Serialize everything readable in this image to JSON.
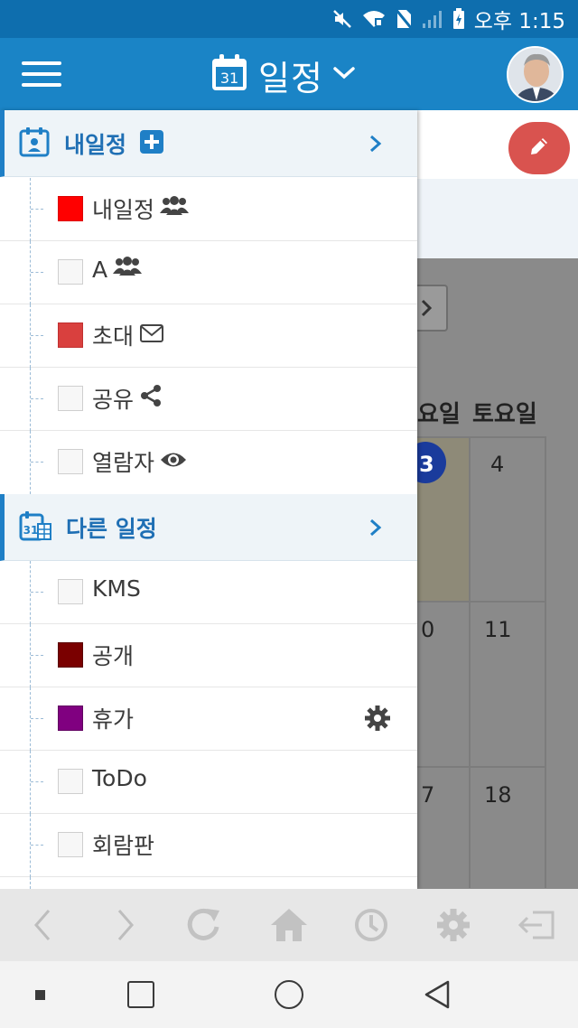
{
  "status_bar": {
    "time": "오후 1:15",
    "icons": [
      "mute-icon",
      "wifi-icon",
      "no-sim-icon",
      "signal-icon",
      "battery-icon"
    ]
  },
  "app_bar": {
    "title": "일정",
    "calendar_icon_day": "31",
    "menu_icon": "hamburger-icon",
    "dropdown_icon": "chevron-down-icon",
    "avatar": "user-avatar"
  },
  "background_calendar": {
    "weekday_headers": [
      "요일",
      "토요일"
    ],
    "rows": [
      {
        "left": "3",
        "right": "4",
        "left_highlight": true
      },
      {
        "left": "0",
        "right": "11"
      },
      {
        "left": "7",
        "right": "18"
      }
    ]
  },
  "drawer": {
    "my_schedule": {
      "title": "내일정",
      "icon": "calendar-person-icon",
      "add_icon": "plus-square-icon",
      "chevron": "chevron-right-icon",
      "items": [
        {
          "label": "내일정",
          "color": "#ff0000",
          "checked": true,
          "icon": "group-icon"
        },
        {
          "label": "A",
          "color": "#f7f7f7",
          "checked": false,
          "icon": "group-icon"
        },
        {
          "label": "초대",
          "color": "#d9403e",
          "checked": true,
          "icon": "envelope-icon"
        },
        {
          "label": "공유",
          "color": "#f7f7f7",
          "checked": false,
          "icon": "share-icon"
        },
        {
          "label": "열람자",
          "color": "#f7f7f7",
          "checked": false,
          "icon": "eye-icon"
        }
      ]
    },
    "other_schedule": {
      "title": "다른 일정",
      "icon": "calendar-grid-icon",
      "chevron": "chevron-right-icon",
      "items": [
        {
          "label": "KMS",
          "color": "#f7f7f7",
          "checked": false
        },
        {
          "label": "공개",
          "color": "#7a0000",
          "checked": true
        },
        {
          "label": "휴가",
          "color": "#800080",
          "checked": true,
          "trailing_icon": "gear-icon"
        },
        {
          "label": "ToDo",
          "color": "#f7f7f7",
          "checked": false
        },
        {
          "label": "회람판",
          "color": "#f7f7f7",
          "checked": false
        }
      ]
    }
  },
  "fab": {
    "icon": "pencil-icon",
    "color": "#d9534f"
  },
  "bottom_toolbar": [
    "back-icon",
    "forward-icon",
    "refresh-icon",
    "home-icon",
    "history-icon",
    "settings-icon",
    "logout-icon"
  ],
  "nav_bar": [
    "recent-dot",
    "overview-square",
    "home-circle",
    "back-triangle"
  ],
  "colors": {
    "primary": "#1a84c6",
    "status_bar": "#0e6eae",
    "section_text": "#1f6fb4"
  }
}
